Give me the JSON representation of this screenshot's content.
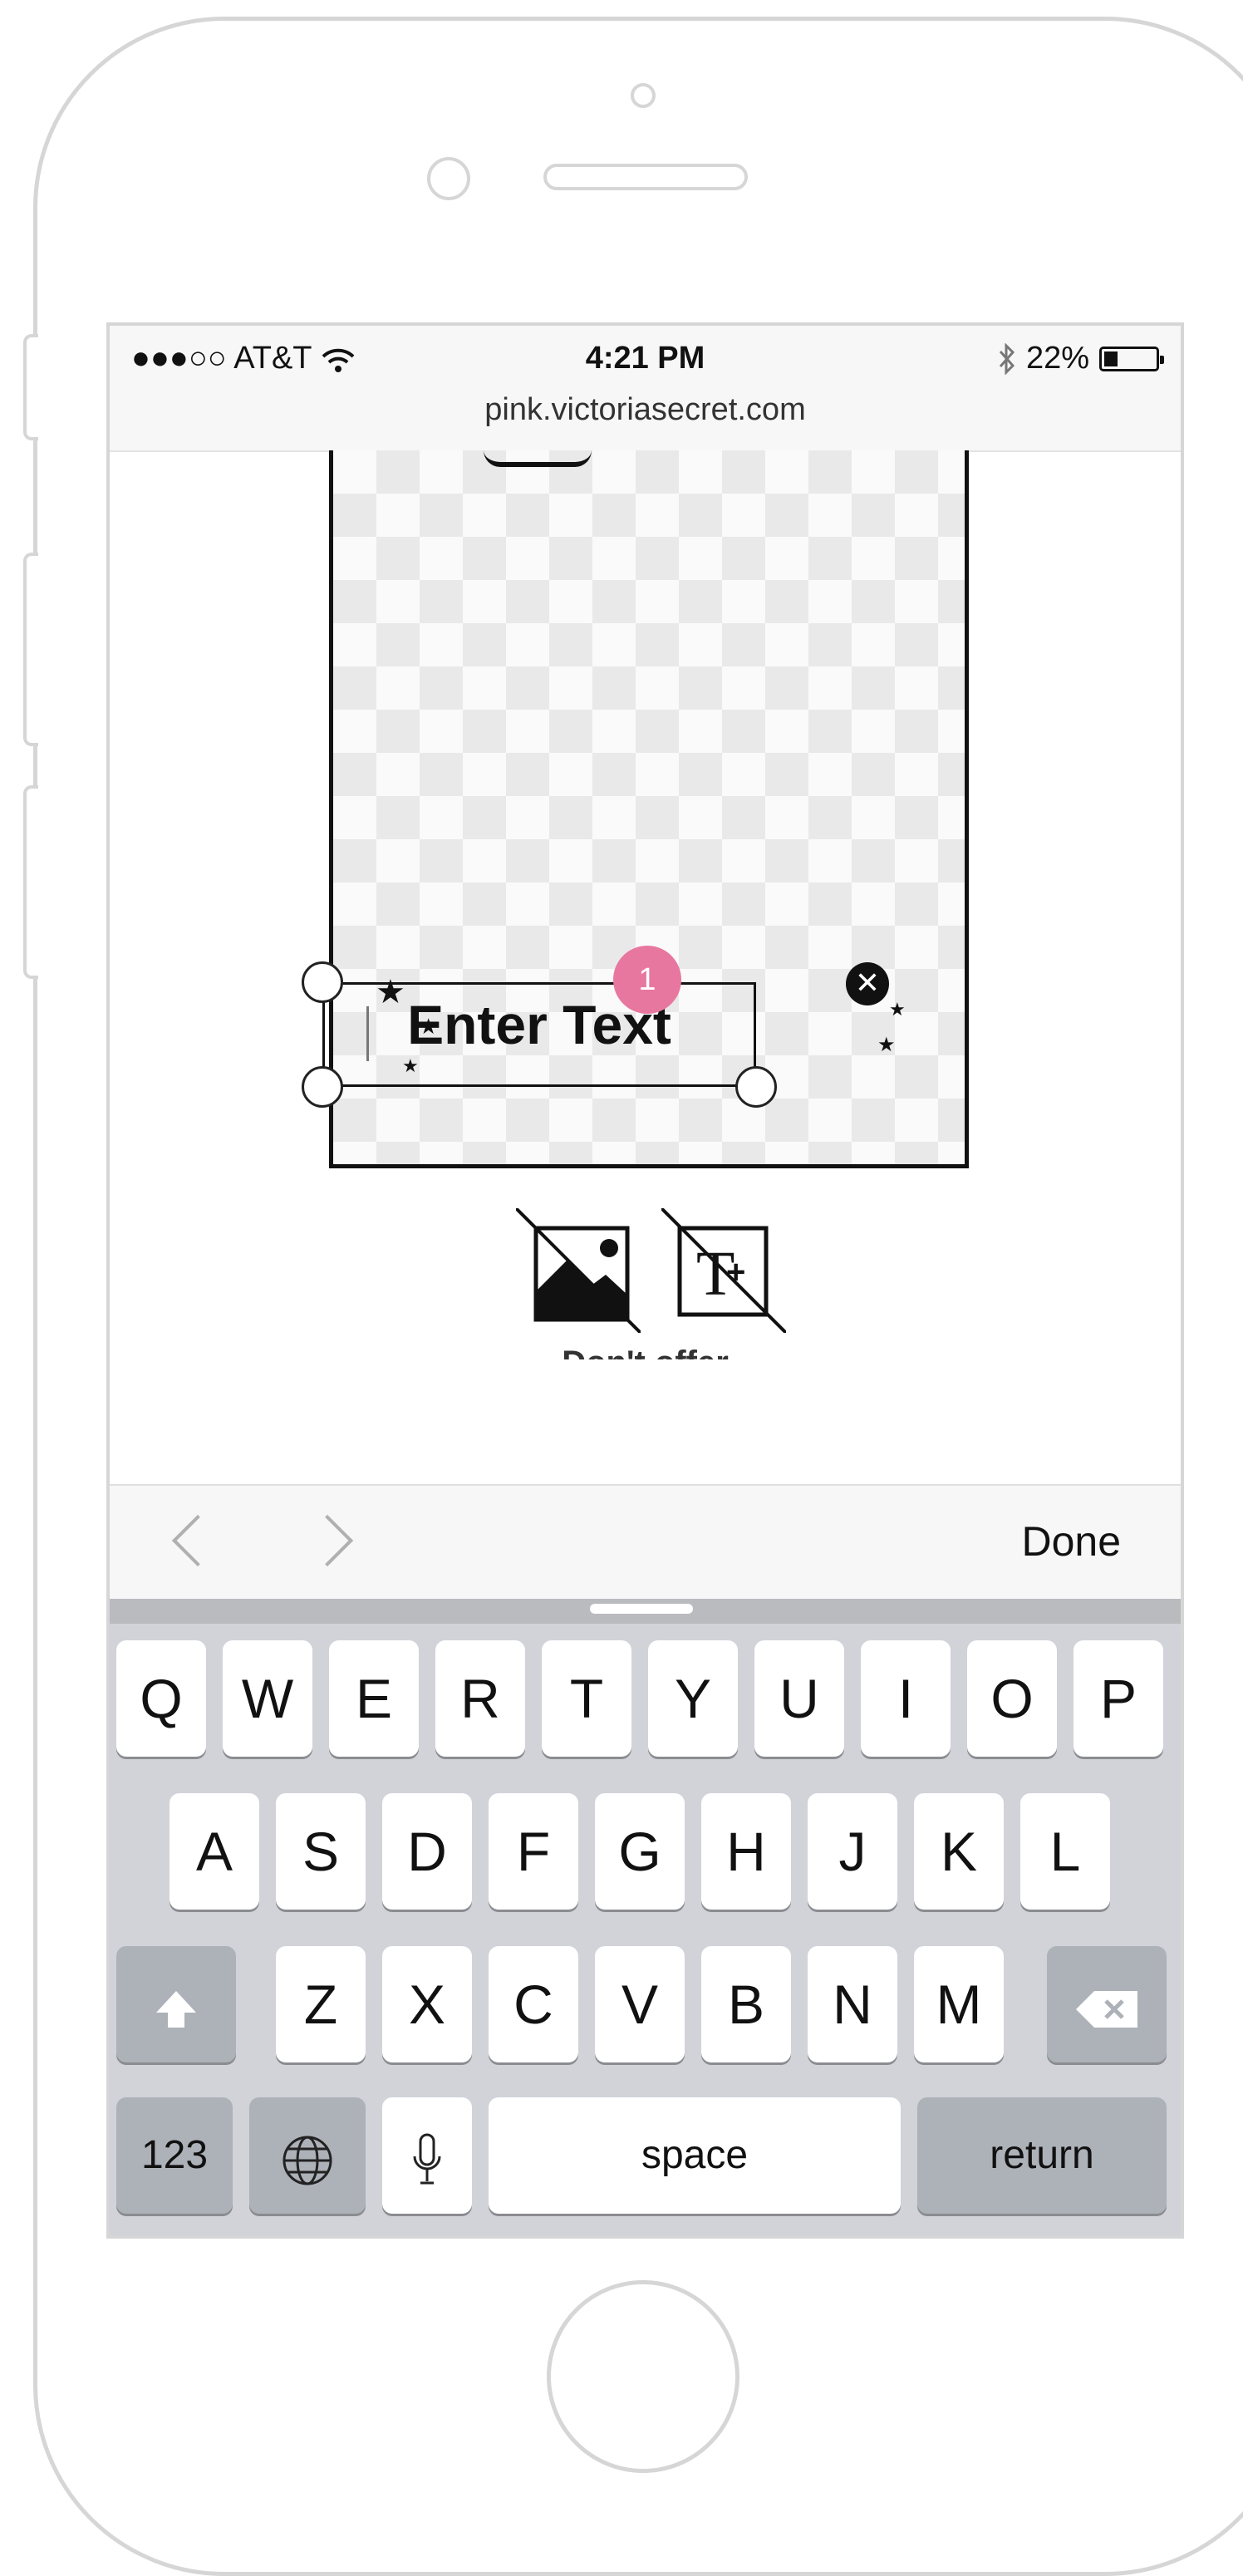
{
  "status_bar": {
    "carrier": "●●●○○ AT&T",
    "time": "4:21 PM",
    "battery": "22%"
  },
  "address": {
    "url": "pink.victoriasecret.com"
  },
  "canvas": {
    "text_placeholder": "Enter Text",
    "step_badge": "1"
  },
  "toolbar": {
    "icons": [
      "add-image-icon",
      "add-text-icon"
    ]
  },
  "page": {
    "cutoff_text": "Don't offer"
  },
  "accessory_bar": {
    "done_label": "Done"
  },
  "keyboard": {
    "row1": [
      "Q",
      "W",
      "E",
      "R",
      "T",
      "Y",
      "U",
      "I",
      "O",
      "P"
    ],
    "row2": [
      "A",
      "S",
      "D",
      "F",
      "G",
      "H",
      "J",
      "K",
      "L"
    ],
    "row3": [
      "Z",
      "X",
      "C",
      "V",
      "B",
      "N",
      "M"
    ],
    "numbers_label": "123",
    "space_label": "space",
    "return_label": "return"
  },
  "colors": {
    "badge": "#e8779f",
    "keyboard_bg": "#d1d3d9",
    "dark_key": "#adb1b8"
  }
}
